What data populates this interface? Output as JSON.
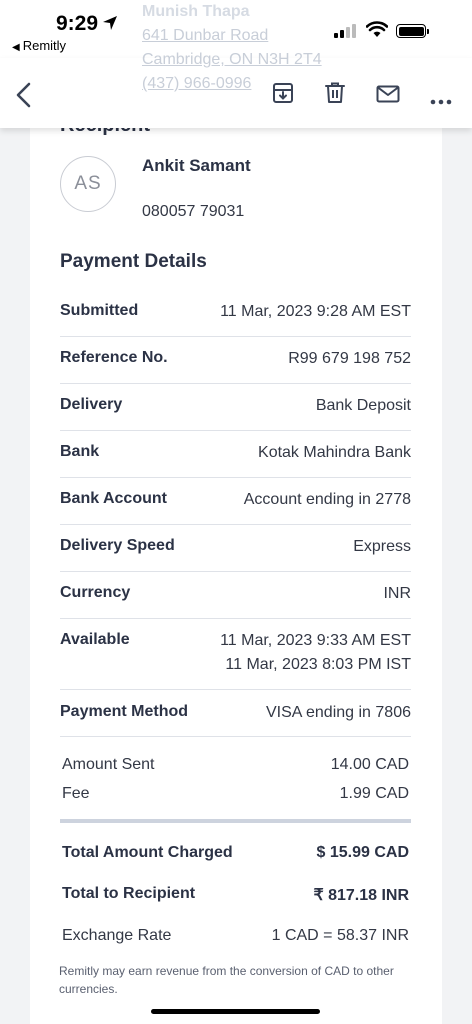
{
  "status_bar": {
    "time": "9:29",
    "back_app": "Remitly"
  },
  "sender_ghost": {
    "name": "Munish Thapa",
    "address_line1": "641 Dunbar Road",
    "address_line2": "Cambridge, ON N3H 2T4",
    "phone": "(437) 966-0996"
  },
  "toolbar": {
    "icons": [
      "back-chevron-icon",
      "archive-download-icon",
      "trash-icon",
      "mail-icon",
      "more-dots-icon"
    ]
  },
  "recipient": {
    "heading": "Recipient",
    "initials": "AS",
    "name": "Ankit Samant",
    "phone": "080057 79031"
  },
  "payment_details": {
    "title": "Payment Details",
    "rows": [
      {
        "label": "Submitted",
        "value": "11 Mar, 2023 9:28 AM EST"
      },
      {
        "label": "Reference No.",
        "value": "R99 679 198 752"
      },
      {
        "label": "Delivery",
        "value": "Bank Deposit"
      },
      {
        "label": "Bank",
        "value": "Kotak Mahindra Bank"
      },
      {
        "label": "Bank Account",
        "value": "Account ending in 2778"
      },
      {
        "label": "Delivery Speed",
        "value": "Express"
      },
      {
        "label": "Currency",
        "value": "INR"
      },
      {
        "label": "Available",
        "value": "11 Mar, 2023 9:33 AM EST",
        "value2": "11 Mar, 2023 8:03 PM IST"
      },
      {
        "label": "Payment Method",
        "value": "VISA ending in 7806"
      }
    ]
  },
  "summary": {
    "amount_sent_label": "Amount Sent",
    "amount_sent_value": "14.00 CAD",
    "fee_label": "Fee",
    "fee_value": "1.99 CAD",
    "total_charged_label": "Total Amount Charged",
    "total_charged_value": "$ 15.99 CAD",
    "total_recipient_label": "Total to Recipient",
    "total_recipient_value": "₹ 817.18 INR",
    "exchange_label": "Exchange Rate",
    "exchange_value": "1 CAD = 58.37 INR"
  },
  "footnote": "Remitly may earn revenue from the conversion of CAD to other currencies."
}
